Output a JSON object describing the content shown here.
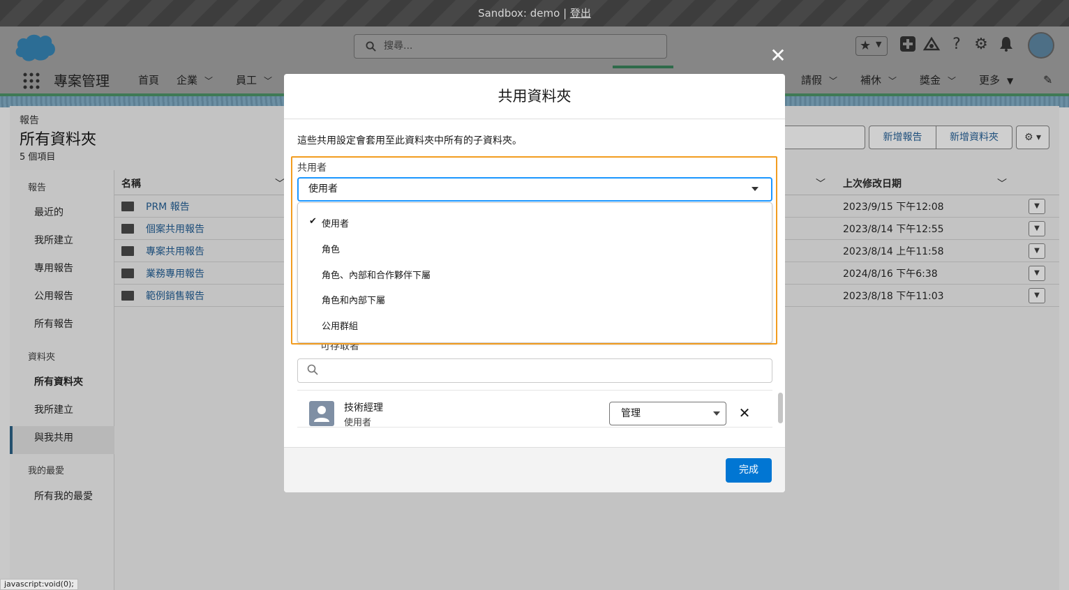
{
  "sandbox_bar": {
    "text": "Sandbox: demo | ",
    "logout": "登出"
  },
  "header": {
    "search_placeholder": "搜尋...",
    "app_name": "專案管理",
    "nav_items": [
      {
        "label": "首頁"
      },
      {
        "label": "企業"
      },
      {
        "label": "員工"
      },
      {
        "label": "請假"
      },
      {
        "label": "補休"
      },
      {
        "label": "獎金"
      },
      {
        "label": "更多"
      }
    ]
  },
  "page": {
    "breadcrumb": "報告",
    "title": "所有資料夾",
    "item_count": "5 個項目",
    "buttons": {
      "new_report": "新增報告",
      "new_folder": "新增資料夾"
    }
  },
  "sidebar": {
    "sections": [
      {
        "title": "報告",
        "items": [
          "最近的",
          "我所建立",
          "專用報告",
          "公用報告",
          "所有報告"
        ]
      },
      {
        "title": "資料夾",
        "items": [
          "所有資料夾",
          "我所建立",
          "與我共用"
        ]
      },
      {
        "title": "我的最愛",
        "items": [
          "所有我的最愛"
        ]
      }
    ]
  },
  "table": {
    "columns": {
      "name": "名稱",
      "modified": "上次修改日期"
    },
    "rows": [
      {
        "name": "PRM 報告",
        "modified": "2023/9/15 下午12:08"
      },
      {
        "name": "個案共用報告",
        "modified": "2023/8/14 下午12:55"
      },
      {
        "name": "專案共用報告",
        "modified": "2023/8/14 上午11:58"
      },
      {
        "name": "業務專用報告",
        "modified": "2024/8/16 下午6:38"
      },
      {
        "name": "範例銷售報告",
        "modified": "2023/8/18 下午11:03"
      }
    ]
  },
  "modal": {
    "title": "共用資料夾",
    "description": "這些共用設定會套用至此資料夾中所有的子資料夾。",
    "share_with_label": "共用者",
    "share_with_value": "使用者",
    "options": [
      "使用者",
      "角色",
      "角色、內部和合作夥伴下屬",
      "角色和內部下屬",
      "公用群組"
    ],
    "selected_option": "使用者",
    "hidden_label": "可存取者",
    "member": {
      "name": "技術經理",
      "type": "使用者",
      "access": "管理"
    },
    "done_label": "完成"
  },
  "status_tip": "javascript:void(0);",
  "colors": {
    "brand_blue": "#0176d3",
    "highlight_orange": "#f29c1f",
    "focus_blue": "#1b96ff"
  },
  "icons": [
    "salesforce-cloud-icon",
    "search-icon",
    "star-icon",
    "plus-icon",
    "trailhead-icon",
    "help-icon",
    "gear-icon",
    "bell-icon",
    "waffle-icon",
    "folder-icon",
    "check-icon",
    "close-icon",
    "user-icon",
    "edit-icon"
  ]
}
